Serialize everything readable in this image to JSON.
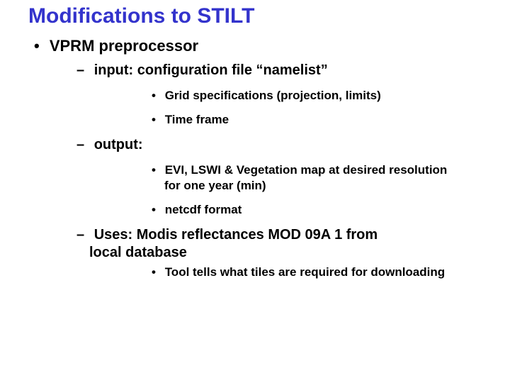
{
  "title": "Modifications to STILT",
  "sections": [
    {
      "label": "VPRM preprocessor",
      "items": [
        {
          "label": "input: configuration file “namelist”",
          "sub": [
            {
              "label": "Grid specifications (projection, limits)"
            },
            {
              "label": "Time frame"
            }
          ]
        },
        {
          "label": "output:",
          "sub": [
            {
              "label": "EVI, LSWI &  Vegetation map at desired resolution",
              "cont": "for one year (min)"
            },
            {
              "label": "netcdf format"
            }
          ]
        },
        {
          "label": "Uses: Modis reflectances MOD 09A 1 from",
          "cont": "local database",
          "sub": [
            {
              "label": "Tool tells what tiles are required for downloading"
            }
          ]
        }
      ]
    }
  ]
}
